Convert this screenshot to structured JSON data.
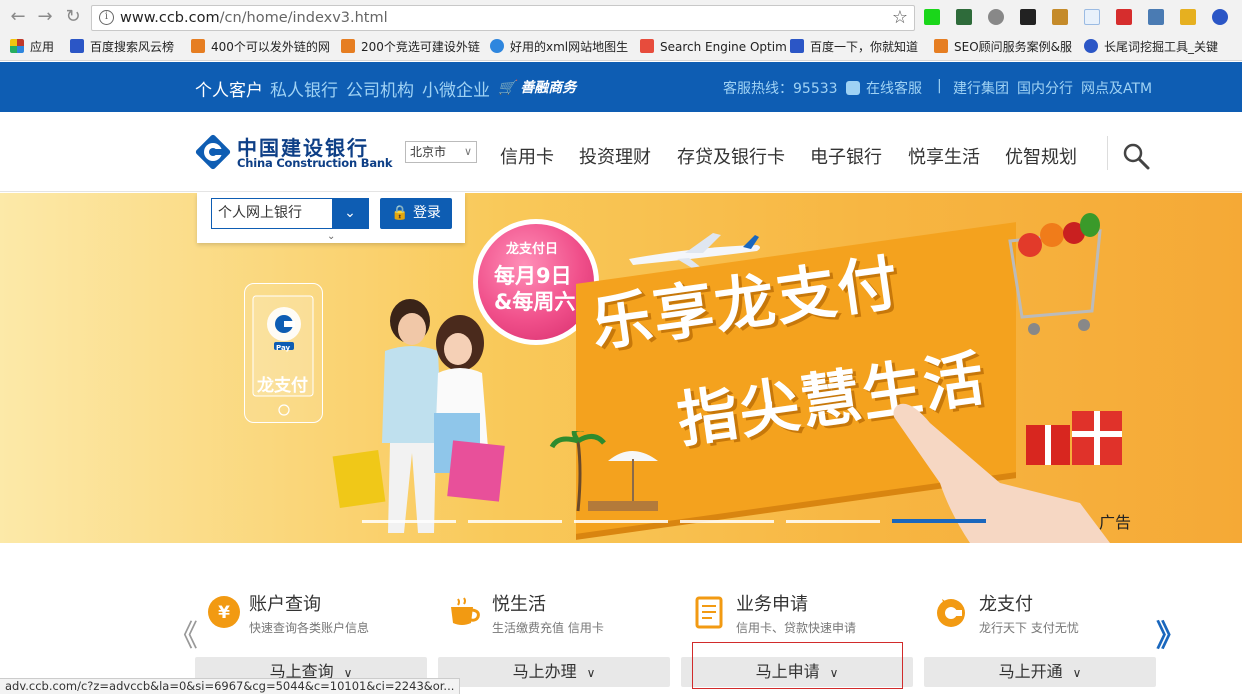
{
  "browser": {
    "url_host": "www.ccb.com",
    "url_path": "/cn/home/indexv3.html",
    "bookmarks": [
      {
        "label": "应用",
        "color": "#c0392b"
      },
      {
        "label": "百度搜索风云榜",
        "color": "#2b56c6"
      },
      {
        "label": "400个可以发外链的网",
        "color": "#e67e22"
      },
      {
        "label": "200个竞选可建设外链",
        "color": "#e67e22"
      },
      {
        "label": "好用的xml网站地图生",
        "color": "#2e86de"
      },
      {
        "label": "Search Engine Optim",
        "color": "#e74c3c"
      },
      {
        "label": "百度一下，你就知道",
        "color": "#2b56c6"
      },
      {
        "label": "SEO顾问服务案例&服",
        "color": "#e67e22"
      },
      {
        "label": "长尾词挖掘工具_关键",
        "color": "#2b56c6"
      }
    ],
    "status_url": "adv.ccb.com/c?z=advccb&la=0&si=6967&cg=5044&c=10101&ci=2243&or..."
  },
  "topbar": {
    "nav": [
      "个人客户",
      "私人银行",
      "公司机构",
      "小微企业"
    ],
    "shop_label": "善融商务",
    "hotline": "客服热线：95533",
    "online_service": "在线客服",
    "sep": "|",
    "links": [
      "建行集团",
      "国内分行",
      "网点及ATM"
    ]
  },
  "header": {
    "logo_cn": "中国建设银行",
    "logo_en": "China Construction Bank",
    "city": "北京市",
    "nav": [
      "信用卡",
      "投资理财",
      "存贷及银行卡",
      "电子银行",
      "悦享生活",
      "优智规划"
    ]
  },
  "login": {
    "select_value": "个人网上银行",
    "button": "登录"
  },
  "banner": {
    "phone_label": "龙支付",
    "phone_pay": "Pay",
    "badge_title": "龙支付日",
    "badge_line1": "每月9日",
    "badge_line2": "&每周六",
    "headline1": "乐享龙支付",
    "headline2": "指尖慧生活",
    "ad_label": "广告",
    "slide_count": 6,
    "active_slide": 6
  },
  "services": {
    "items": [
      {
        "title": "账户查询",
        "subtitle": "快速查询各类账户信息",
        "button": "马上查询"
      },
      {
        "title": "悦生活",
        "subtitle": "生活缴费充值 信用卡",
        "button": "马上办理"
      },
      {
        "title": "业务申请",
        "subtitle": "信用卡、贷款快速申请",
        "button": "马上申请"
      },
      {
        "title": "龙支付",
        "subtitle": "龙行天下 支付无忧",
        "button": "马上开通"
      }
    ],
    "prev_glyph": "《",
    "next_glyph": "》"
  },
  "colors": {
    "brand_blue": "#0e5db3",
    "banner_orange": "#f4a21e",
    "highlight_red": "#d12b2b"
  }
}
